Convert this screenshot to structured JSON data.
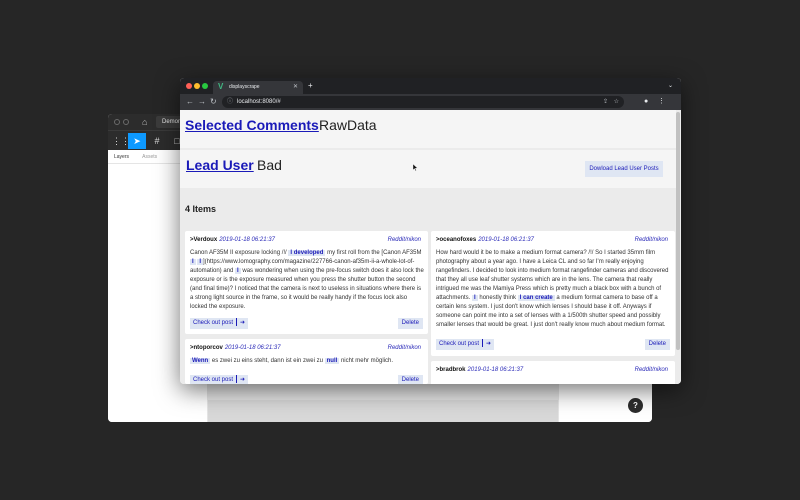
{
  "back_window": {
    "tab_title": "Demonst",
    "panel_tabs": [
      "Layers",
      "Assets"
    ],
    "help_label": "?"
  },
  "browser": {
    "tab_title": "displayscrape",
    "new_tab": "+",
    "url": "localhost:8080/#"
  },
  "page": {
    "tabs1": {
      "active": "Selected Comments",
      "inactive": "RawData"
    },
    "tabs2": {
      "active": "Lead User",
      "inactive": "Bad"
    },
    "download_button": "Dowload Lead User Posts",
    "items_count": "4 Items",
    "checkout_label": "Check out post",
    "delete_label": "Delete",
    "comments": [
      {
        "user": ">Verdoux",
        "date": "2019-01-18 06:21:37",
        "subreddit": "Reddit/nikon",
        "body": [
          {
            "t": "Canon AF35M II exposure locking /!/ "
          },
          {
            "t": "I developed",
            "hl": true
          },
          {
            "t": " my first roll from the [Canon AF35M "
          },
          {
            "t": "I",
            "hl": true
          },
          {
            "t": " "
          },
          {
            "t": "I",
            "hl": true
          },
          {
            "t": "](https://www.lomography.com/magazine/227766-canon-af35m-ii-a-whole-lot-of-automation) and "
          },
          {
            "t": "I",
            "hl": true
          },
          {
            "t": " was wondering when using the pre-focus switch does it also lock the exposure or is the exposure measured when you press the shutter button the second (and final time)? I noticed that the camera is next to useless in situations where there is a strong light source in the frame, so it would be really handy if the focus lock also locked the exposure."
          }
        ]
      },
      {
        "user": ">ntoporcov",
        "date": "2019-01-18 06:21:37",
        "subreddit": "Reddit/nikon",
        "body": [
          {
            "t": "Wenn",
            "hl": true
          },
          {
            "t": " es zwei zu eins steht, dann ist ein zwei zu "
          },
          {
            "t": "null",
            "hl": true
          },
          {
            "t": " nicht mehr möglich."
          }
        ]
      },
      {
        "user": ">oceanofoxes",
        "date": "2019-01-18 06:21:37",
        "subreddit": "Reddit/nikon",
        "body": [
          {
            "t": "How hard would it be to make a medium format camera? /!/ So I started 35mm film photography about a year ago. I have a Leica CL and so far I'm really enjoying rangefinders. I decided to look into medium format rangefinder cameras and discovered that they all use leaf shutter systems which are in the lens. The camera that really intrigued me was the Mamiya Press which is pretty much a black box with a bunch of attachments. "
          },
          {
            "t": "I",
            "hl": true
          },
          {
            "t": " honestly think "
          },
          {
            "t": "I can create",
            "hl": true
          },
          {
            "t": " a medium format camera to base off a certain lens system. I just don't know which lenses I should base it off. Anyways if someone can point me into a set of lenses with a 1/500th shutter speed and possibly smaller lenses that would be great. I just don't really know much about medium format."
          }
        ]
      },
      {
        "user": ">bradbrok",
        "date": "2019-01-18 06:21:37",
        "subreddit": "Reddit/nikon",
        "body": []
      }
    ]
  }
}
